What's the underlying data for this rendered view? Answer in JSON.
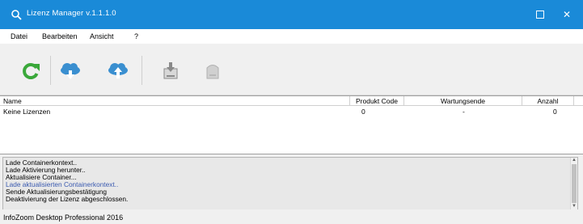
{
  "window": {
    "title": "Lizenz Manager v.1.1.1.0",
    "close_glyph": "✕"
  },
  "menu": {
    "items": [
      "Datei",
      "Bearbeiten",
      "Ansicht",
      "?"
    ]
  },
  "toolbar": {
    "icons": [
      "refresh-icon",
      "cloud-download-icon",
      "cloud-upload-icon",
      "save-to-device-icon",
      "device-icon"
    ]
  },
  "license_table": {
    "columns": [
      "Name",
      "Produkt Code",
      "Wartungsende",
      "Anzahl"
    ],
    "rows": [
      {
        "name": "Keine Lizenzen",
        "product_code": "0",
        "maintenance_end": "-",
        "count": "0"
      }
    ]
  },
  "log": {
    "lines": [
      {
        "text": "Lade Containerkontext..",
        "color": "#000000"
      },
      {
        "text": "Lade Aktivierung herunter..",
        "color": "#000000"
      },
      {
        "text": "Aktualisiere Container...",
        "color": "#000000"
      },
      {
        "text": "Lade aktualisierten Containerkontext..",
        "color": "#3a5ab0"
      },
      {
        "text": "Sende Aktualisierungsbestätigung",
        "color": "#000000"
      },
      {
        "text": "Deaktivierung der Lizenz abgeschlossen.",
        "color": "#000000"
      }
    ]
  },
  "status": {
    "text": "InfoZoom Desktop Professional 2016"
  },
  "colors": {
    "titlebar": "#1a8ad8",
    "refresh": "#3aa83a",
    "cloud": "#3a8fd0"
  }
}
